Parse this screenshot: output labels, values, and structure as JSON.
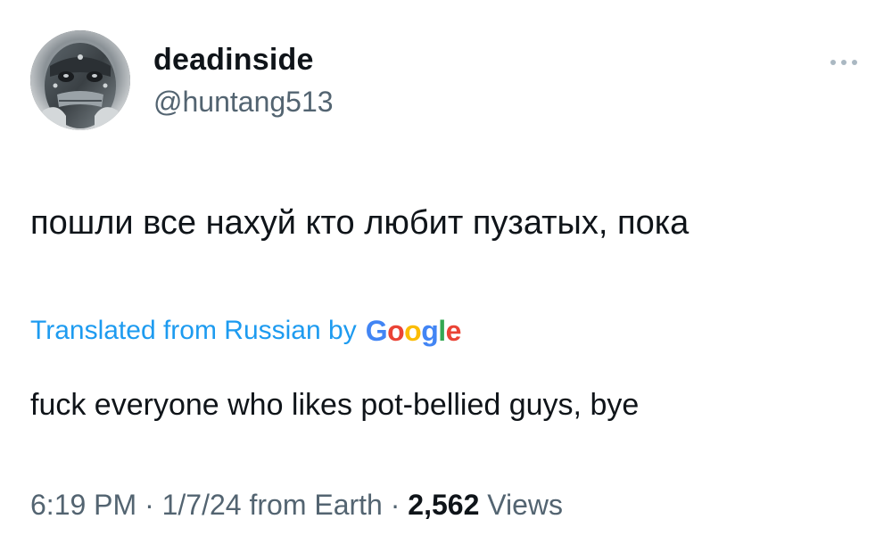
{
  "author": {
    "display_name": "deadinside",
    "handle": "@huntang513"
  },
  "tweet": {
    "text": "пошли все нахуй кто любит пузатых, пока"
  },
  "translation": {
    "label": "Translated from Russian by",
    "provider": [
      "G",
      "o",
      "o",
      "g",
      "l",
      "e"
    ],
    "provider_colors": [
      "#4285F4",
      "#EA4335",
      "#FBBC05",
      "#4285F4",
      "#34A853",
      "#EA4335"
    ],
    "text": "fuck everyone who likes pot-bellied guys, bye"
  },
  "meta": {
    "time": "6:19 PM",
    "separator_1": " · ",
    "date": "1/7/24",
    "from_label": " from Earth",
    "separator_2": " · ",
    "views_count": "2,562",
    "views_label": " Views"
  },
  "icons": {
    "more": "more-horizontal-icon",
    "avatar": "masked-face-avatar"
  }
}
